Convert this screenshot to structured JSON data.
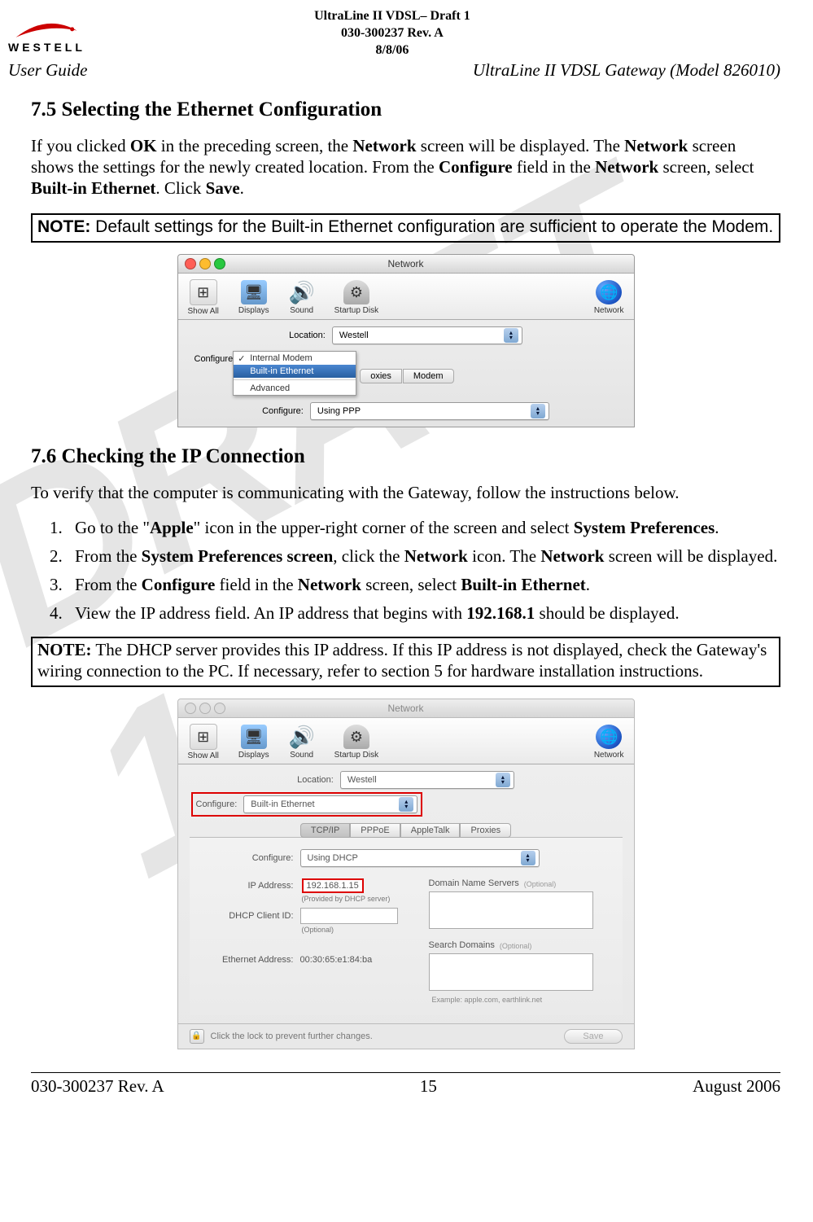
{
  "header": {
    "doc_title": "UltraLine II VDSL– Draft 1",
    "doc_rev": "030-300237 Rev. A",
    "doc_date": "8/8/06",
    "logo_text": "WESTELL",
    "user_guide": "User Guide",
    "product": "UltraLine II VDSL Gateway (Model 826010)"
  },
  "watermark": "DRAFT 1",
  "sections": {
    "s75": {
      "heading": "7.5   Selecting the Ethernet Configuration",
      "para1_pre": "If you clicked ",
      "ok": "OK",
      "para1_mid1": " in the preceding screen, the ",
      "network1": "Network",
      "para1_mid2": " screen will be displayed. The ",
      "network2": "Network",
      "para1_mid3": " screen shows the settings for the newly created location. From the ",
      "configure": "Configure",
      "para1_mid4": " field in the ",
      "network3": "Network",
      "para1_mid5": " screen, select ",
      "bie": "Built-in Ethernet",
      "para1_end": ". Click ",
      "save": "Save",
      "dot": ".",
      "note_label": "NOTE:",
      "note_body": " Default settings for the Built-in Ethernet configuration are sufficient to operate the Modem."
    },
    "screenshot1": {
      "title": "Network",
      "toolbar": {
        "show_all": "Show All",
        "displays": "Displays",
        "sound": "Sound",
        "startup_disk": "Startup Disk",
        "network": "Network"
      },
      "location_label": "Location:",
      "location_value": "Westell",
      "configure_label": "Configure",
      "menu": {
        "internal_modem": "Internal Modem",
        "built_in_ethernet": "Built-in Ethernet",
        "advanced": "Advanced"
      },
      "tabs": {
        "proxies": "oxies",
        "modem": "Modem"
      },
      "configure2_label": "Configure:",
      "configure2_value": "Using PPP"
    },
    "s76": {
      "heading": "7.6   Checking the IP Connection",
      "intro": "To verify that the computer is communicating with the Gateway, follow the instructions below.",
      "li1_pre": "Go to the \"",
      "li1_apple": "Apple",
      "li1_mid": "\" icon in the upper-right corner of the screen and select ",
      "li1_sysprefs": "System Preferences",
      "li1_end": ".",
      "li2_pre": "From the ",
      "li2_spscreen": "System Preferences screen",
      "li2_mid": ", click the ",
      "li2_network": "Network",
      "li2_mid2": " icon. The ",
      "li2_network2": "Network",
      "li2_end": " screen will be displayed.",
      "li3_pre": "From the ",
      "li3_configure": "Configure",
      "li3_mid": " field in the ",
      "li3_network": "Network",
      "li3_mid2": " screen, select ",
      "li3_bie": "Built-in Ethernet",
      "li3_end": ".",
      "li4_pre": "View the IP address field. An IP address that begins with ",
      "li4_ip": "192.168.1",
      "li4_end": " should be displayed.",
      "note_label": "NOTE:",
      "note_body": " The DHCP server provides this IP address. If this IP address is not displayed, check the Gateway's wiring connection to the PC. If necessary, refer to section 5 for hardware installation instructions."
    },
    "screenshot2": {
      "title": "Network",
      "toolbar": {
        "show_all": "Show All",
        "displays": "Displays",
        "sound": "Sound",
        "startup_disk": "Startup Disk",
        "network": "Network"
      },
      "location_label": "Location:",
      "location_value": "Westell",
      "configure_label": "Configure:",
      "configure_value": "Built-in Ethernet",
      "tabs": {
        "tcpip": "TCP/IP",
        "pppoe": "PPPoE",
        "appletalk": "AppleTalk",
        "proxies": "Proxies"
      },
      "tcpip": {
        "configure_label": "Configure:",
        "configure_value": "Using DHCP",
        "ip_label": "IP Address:",
        "ip_value": "192.168.1.15",
        "ip_provided": "(Provided by DHCP server)",
        "dhcp_client_label": "DHCP Client ID:",
        "dhcp_client_optional": "(Optional)",
        "ethernet_label": "Ethernet Address:",
        "ethernet_value": "00:30:65:e1:84:ba",
        "dns_label": "Domain Name Servers",
        "optional": "(Optional)",
        "search_label": "Search Domains",
        "example": "Example: apple.com, earthlink.net"
      },
      "lock_text": "Click the lock to prevent further changes.",
      "save_btn": "Save"
    }
  },
  "footer": {
    "left": "030-300237 Rev. A",
    "center": "15",
    "right": "August 2006"
  }
}
